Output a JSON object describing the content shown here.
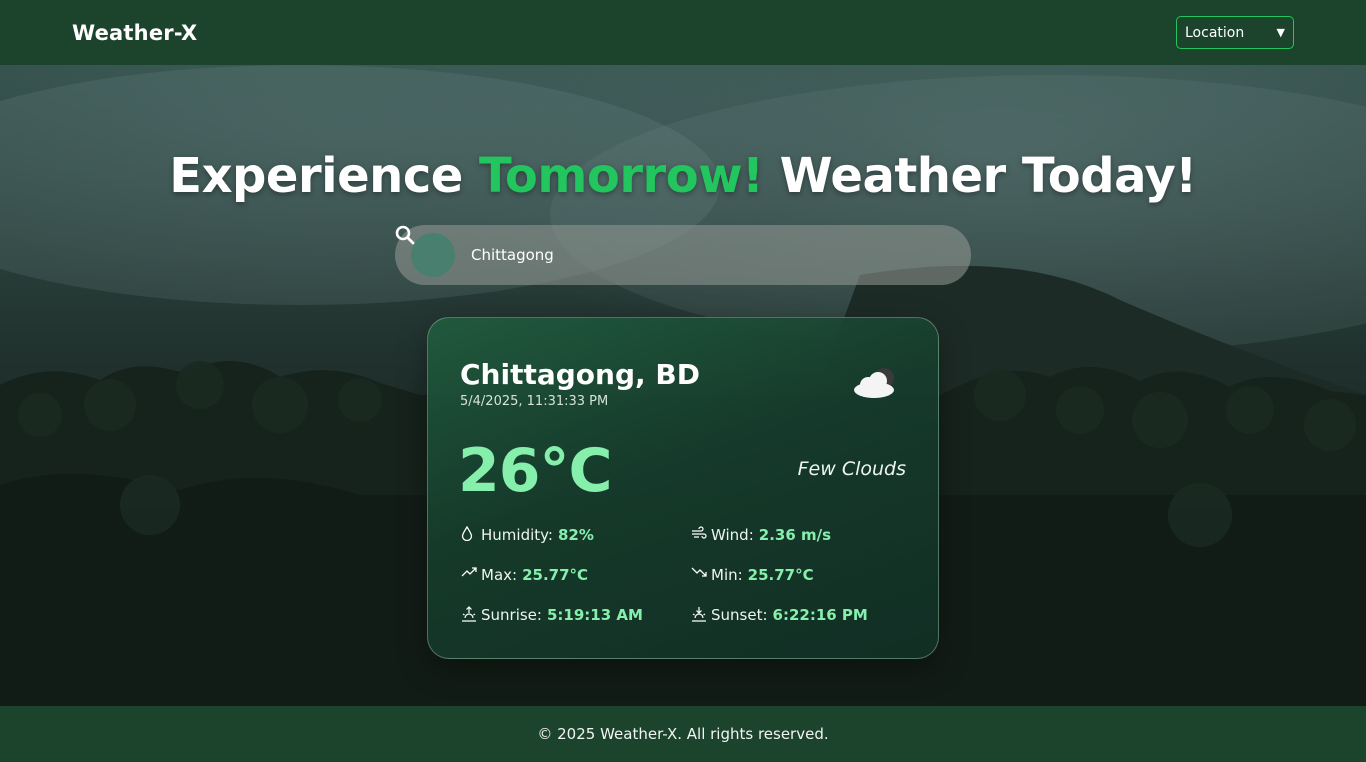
{
  "header": {
    "brand": "Weather-X",
    "location_select": {
      "selected": "Location"
    }
  },
  "hero": {
    "headline_start": "Experience",
    "headline_accent": "Tomorrow!",
    "headline_end": "Weather Today!",
    "search": {
      "value": "Chittagong",
      "icon": "search-icon"
    }
  },
  "card": {
    "city": "Chittagong, BD",
    "datetime": "5/4/2025, 11:31:33 PM",
    "condition_icon": "cloud-night-icon",
    "temperature": "26°C",
    "description": "Few Clouds",
    "stats": {
      "humidity": {
        "label": "Humidity:",
        "value": "82%",
        "icon": "droplet-icon"
      },
      "wind": {
        "label": "Wind:",
        "value": "2.36 m/s",
        "icon": "wind-icon"
      },
      "max": {
        "label": "Max:",
        "value": "25.77°C",
        "icon": "trend-up-icon"
      },
      "min": {
        "label": "Min:",
        "value": "25.77°C",
        "icon": "trend-down-icon"
      },
      "sunrise": {
        "label": "Sunrise:",
        "value": "5:19:13 AM",
        "icon": "sunrise-icon"
      },
      "sunset": {
        "label": "Sunset:",
        "value": "6:22:16 PM",
        "icon": "sunset-icon"
      }
    }
  },
  "footer": {
    "text": "© 2025 Weather-X. All rights reserved."
  },
  "colors": {
    "header_bg": "#1c432c",
    "accent_green": "#22c55e",
    "value_green": "#86efac"
  }
}
